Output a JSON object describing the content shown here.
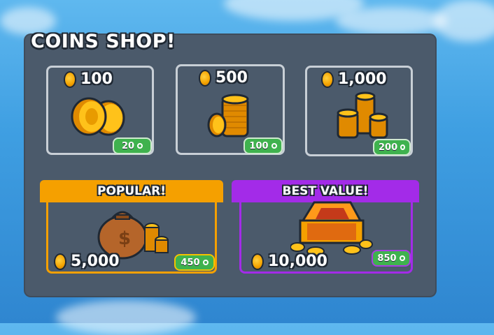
{
  "shop": {
    "title": "COINS SHOP!",
    "packs": [
      {
        "amount": "100",
        "price": "20"
      },
      {
        "amount": "500",
        "price": "100"
      },
      {
        "amount": "1,000",
        "price": "200"
      }
    ],
    "featured": [
      {
        "banner": "POPULAR!",
        "amount": "5,000",
        "price": "450"
      },
      {
        "banner": "BEST VALUE!",
        "amount": "10,000",
        "price": "850"
      }
    ]
  },
  "colors": {
    "panel": "#4b5a6b",
    "popular": "#f5a000",
    "best_value": "#a32be8",
    "price_green": "#3fb24e",
    "coin": "#f4a300"
  },
  "icons": {
    "currency": "robux-icon",
    "coin": "coin-icon"
  }
}
